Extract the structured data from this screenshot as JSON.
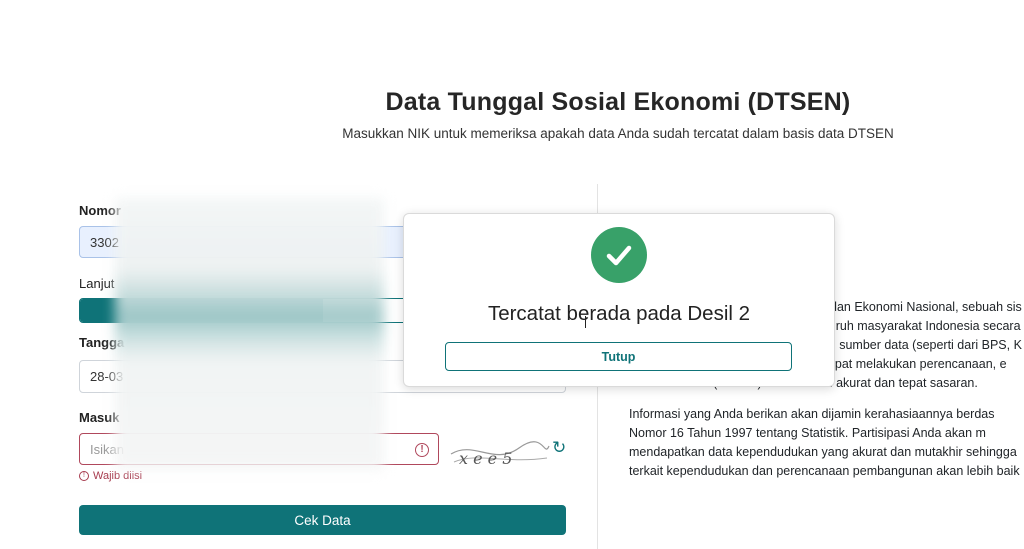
{
  "header": {
    "title": "Data Tunggal Sosial Ekonomi (DTSEN)",
    "subtitle": "Masukkan NIK untuk memeriksa apakah data Anda sudah tercatat dalam basis data DTSEN"
  },
  "form": {
    "nik_label": "Nomor",
    "nik_value": "3302",
    "next_label": "Lanjut",
    "toggle_off_label": "I",
    "date_label": "Tangga",
    "date_value": "28-03",
    "captcha_label": "Masuk",
    "captcha_placeholder": "Isikan",
    "captcha_text": "x e e 5",
    "required_text": "Wajib diisi",
    "submit_label": "Cek Data",
    "error_icon": "!"
  },
  "info": {
    "p1": [
      "dan Ekonomi Nasional, sebuah sis",
      "luruh masyarakat Indonesia secara",
      "ai sumber data (seperti dari BPS, K",
      "dapat melakukan perencanaan, e",
      "bantuan sosial (bansos) secara lebih akurat dan tepat sasaran."
    ],
    "p2": [
      "Informasi yang Anda berikan akan dijamin kerahasiaannya berdas",
      "Nomor 16 Tahun 1997 tentang Statistik. Partisipasi Anda akan m",
      "mendapatkan data kependudukan yang akurat dan mutakhir sehingga",
      "terkait kependudukan dan perencanaan pembangunan akan lebih baik"
    ]
  },
  "modal": {
    "title": "Tercatat berada pada Desil 2",
    "close_label": "Tutup",
    "icon": "check-circle-icon"
  },
  "colors": {
    "primary": "#0f7378",
    "success": "#38a169",
    "error": "#a73b4e"
  }
}
